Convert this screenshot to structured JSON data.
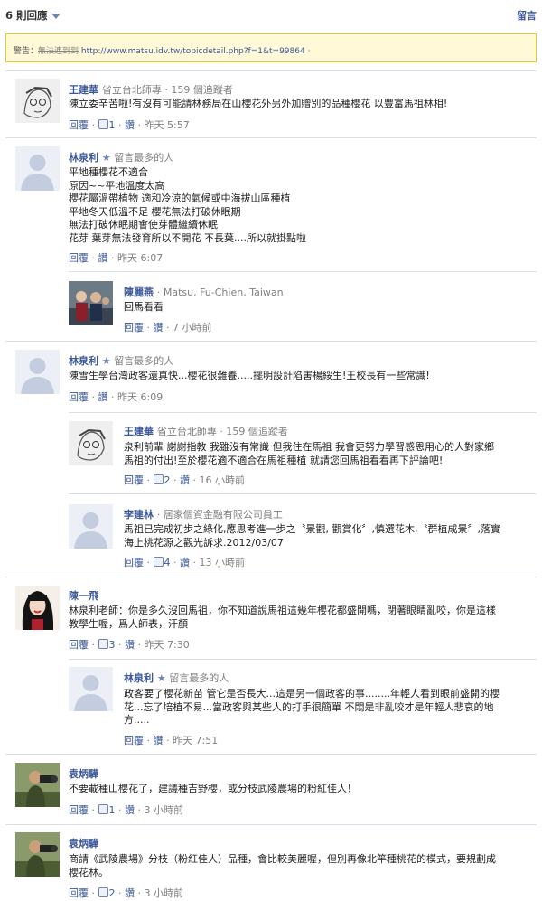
{
  "header": {
    "count": "6 則回應",
    "post": "留言"
  },
  "warning": {
    "label": "警告：",
    "struck": "無法連到到",
    "url": "http://www.matsu.idv.tw/topicdetail.php?f=1&t=99864"
  },
  "actions": {
    "reply": "回覆",
    "like": "讚",
    "dot": "·"
  },
  "comments": [
    {
      "name": "王建華",
      "meta": "省立台北師專 · 159 個追蹤者",
      "lines": [
        "陳立委辛苦啦!有沒有可能請林務局在山櫻花外另外加贈別的品種櫻花 以豐富馬祖林相!"
      ],
      "likes": "1",
      "time": "昨天 5:57"
    },
    {
      "name": "林泉利",
      "meta": "留言最多的人",
      "lines": [
        "平地種櫻花不適合",
        "原因~~平地溫度太高",
        "櫻花屬溫帶植物 適和冷涼的氣候或中海拔山區種植",
        "平地冬天低溫不足 櫻花無法打破休眠期",
        "無法打破休眠期會使芽體繼續休眠",
        "花芽 葉芽無法發育所以不開花 不長葉....所以就掛點啦"
      ],
      "time": "昨天 6:07"
    },
    {
      "name": "陳麗燕",
      "meta": "Matsu, Fu-Chien, Taiwan",
      "lines": [
        "回馬看看"
      ],
      "time": "7 小時前"
    },
    {
      "name": "林泉利",
      "meta": "留言最多的人",
      "lines": [
        "陳雪生學台灣政客還真快...櫻花很難養.....擺明設計陷害楊綏生!王校長有一些常識!"
      ],
      "time": "昨天 6:09"
    },
    {
      "name": "王建華",
      "meta": "省立台北師專 · 159 個追蹤者",
      "lines": [
        "泉利前輩 謝謝指教 我雖沒有常識 但我住在馬祖 我會更努力學習感恩用心的人對家鄉",
        "馬祖的付出!至於櫻花適不適合在馬祖種植 就請您回馬祖看看再下評論吧!"
      ],
      "likes": "2",
      "time": "16 小時前"
    },
    {
      "name": "李建林",
      "meta": "居家個資金融有限公司員工",
      "lines": [
        "馬祖已完成初步之綠化,應思考進一步之〝景觀, 觀賞化〞,慎選花木,〝群植成景〞,落實",
        "海上桃花源之觀光訴求.2012/03/07"
      ],
      "likes": "4",
      "time": "13 小時前"
    },
    {
      "name": "陳一飛",
      "meta": "",
      "lines": [
        "林泉利老師：你是多久沒回馬祖，你不知道說馬祖這幾年櫻花都盛開嗎，閉著眼睛亂咬，你是這樣",
        "教學生喔，爲人師表，汗顏"
      ],
      "likes": "3",
      "time": "昨天 7:30"
    },
    {
      "name": "林泉利",
      "meta": "留言最多的人",
      "lines": [
        "政客要了櫻花新苗 管它是否長大...這是另一個政客的事........年輕人看到眼前盛開的櫻",
        "花...忘了培植不易...當政客與某些人的打手很簡單 不悶是非亂咬才是年輕人悲哀的地",
        "方....."
      ],
      "time": "昨天 7:51"
    },
    {
      "name": "袁炳驊",
      "meta": "",
      "lines": [
        "不要載種山櫻花了，建議種吉野櫻，或分枝武陵農場的粉紅佳人！"
      ],
      "likes": "1",
      "time": "3 小時前"
    },
    {
      "name": "袁炳驊",
      "meta": "",
      "lines": [
        "商請《武陵農場》分枝（粉紅佳人）品種，會比較美麗喔，但別再像北竿種桃花的模式，要規劃成",
        "櫻花林。"
      ],
      "likes": "2",
      "time": "3 小時前"
    }
  ]
}
